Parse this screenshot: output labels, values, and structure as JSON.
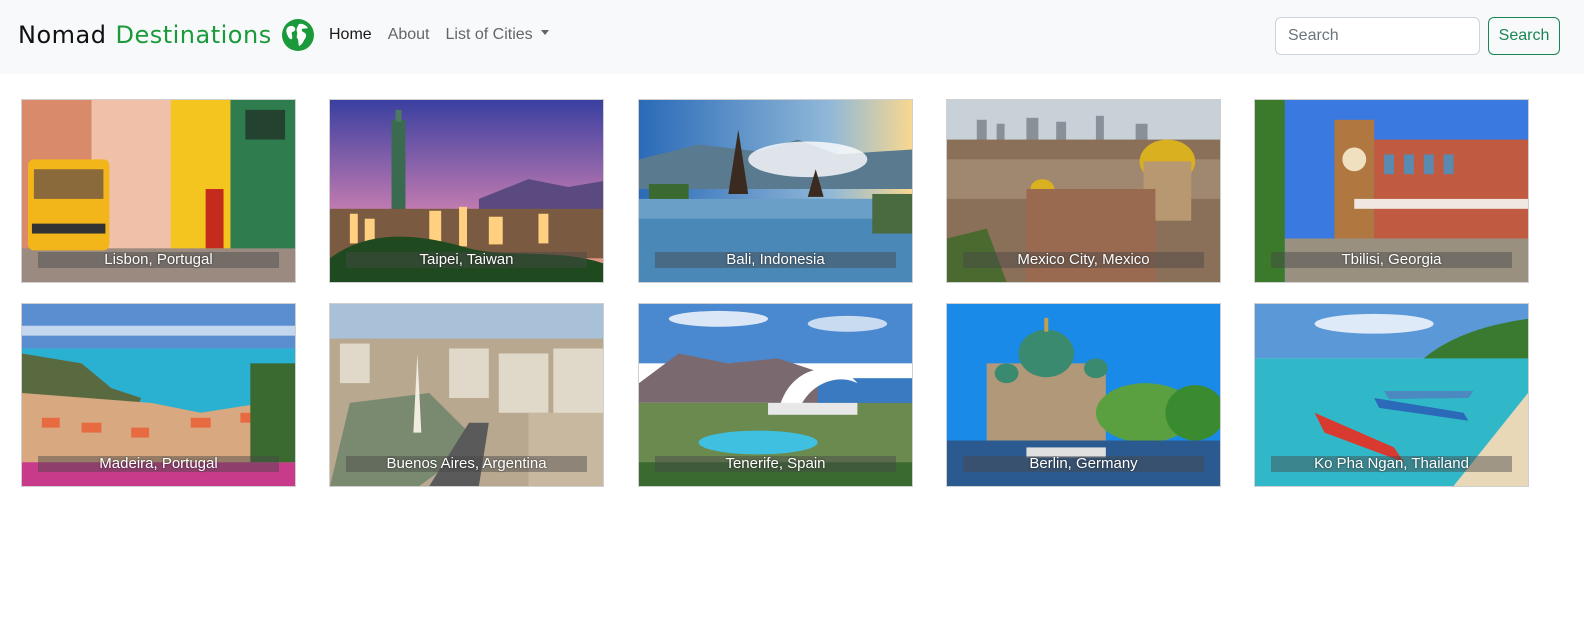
{
  "navbar": {
    "brand_part1": "Nomad",
    "brand_part2": "Destinations",
    "brand_icon": "globe-icon",
    "links": [
      {
        "label": "Home",
        "active": true
      },
      {
        "label": "About",
        "active": false
      },
      {
        "label": "List of Cities",
        "active": false,
        "dropdown": true
      }
    ],
    "search_placeholder": "Search",
    "search_button": "Search"
  },
  "colors": {
    "navbar_bg": "#f8f9fa",
    "brand_accent": "#1a9a3a",
    "search_button": "#198754"
  },
  "cities": [
    {
      "label": "Lisbon, Portugal"
    },
    {
      "label": "Taipei, Taiwan"
    },
    {
      "label": "Bali, Indonesia"
    },
    {
      "label": "Mexico City, Mexico"
    },
    {
      "label": "Tbilisi, Georgia"
    },
    {
      "label": "Madeira, Portugal"
    },
    {
      "label": "Buenos Aires, Argentina"
    },
    {
      "label": "Tenerife, Spain"
    },
    {
      "label": "Berlin, Germany"
    },
    {
      "label": "Ko Pha Ngan, Thailand"
    }
  ]
}
